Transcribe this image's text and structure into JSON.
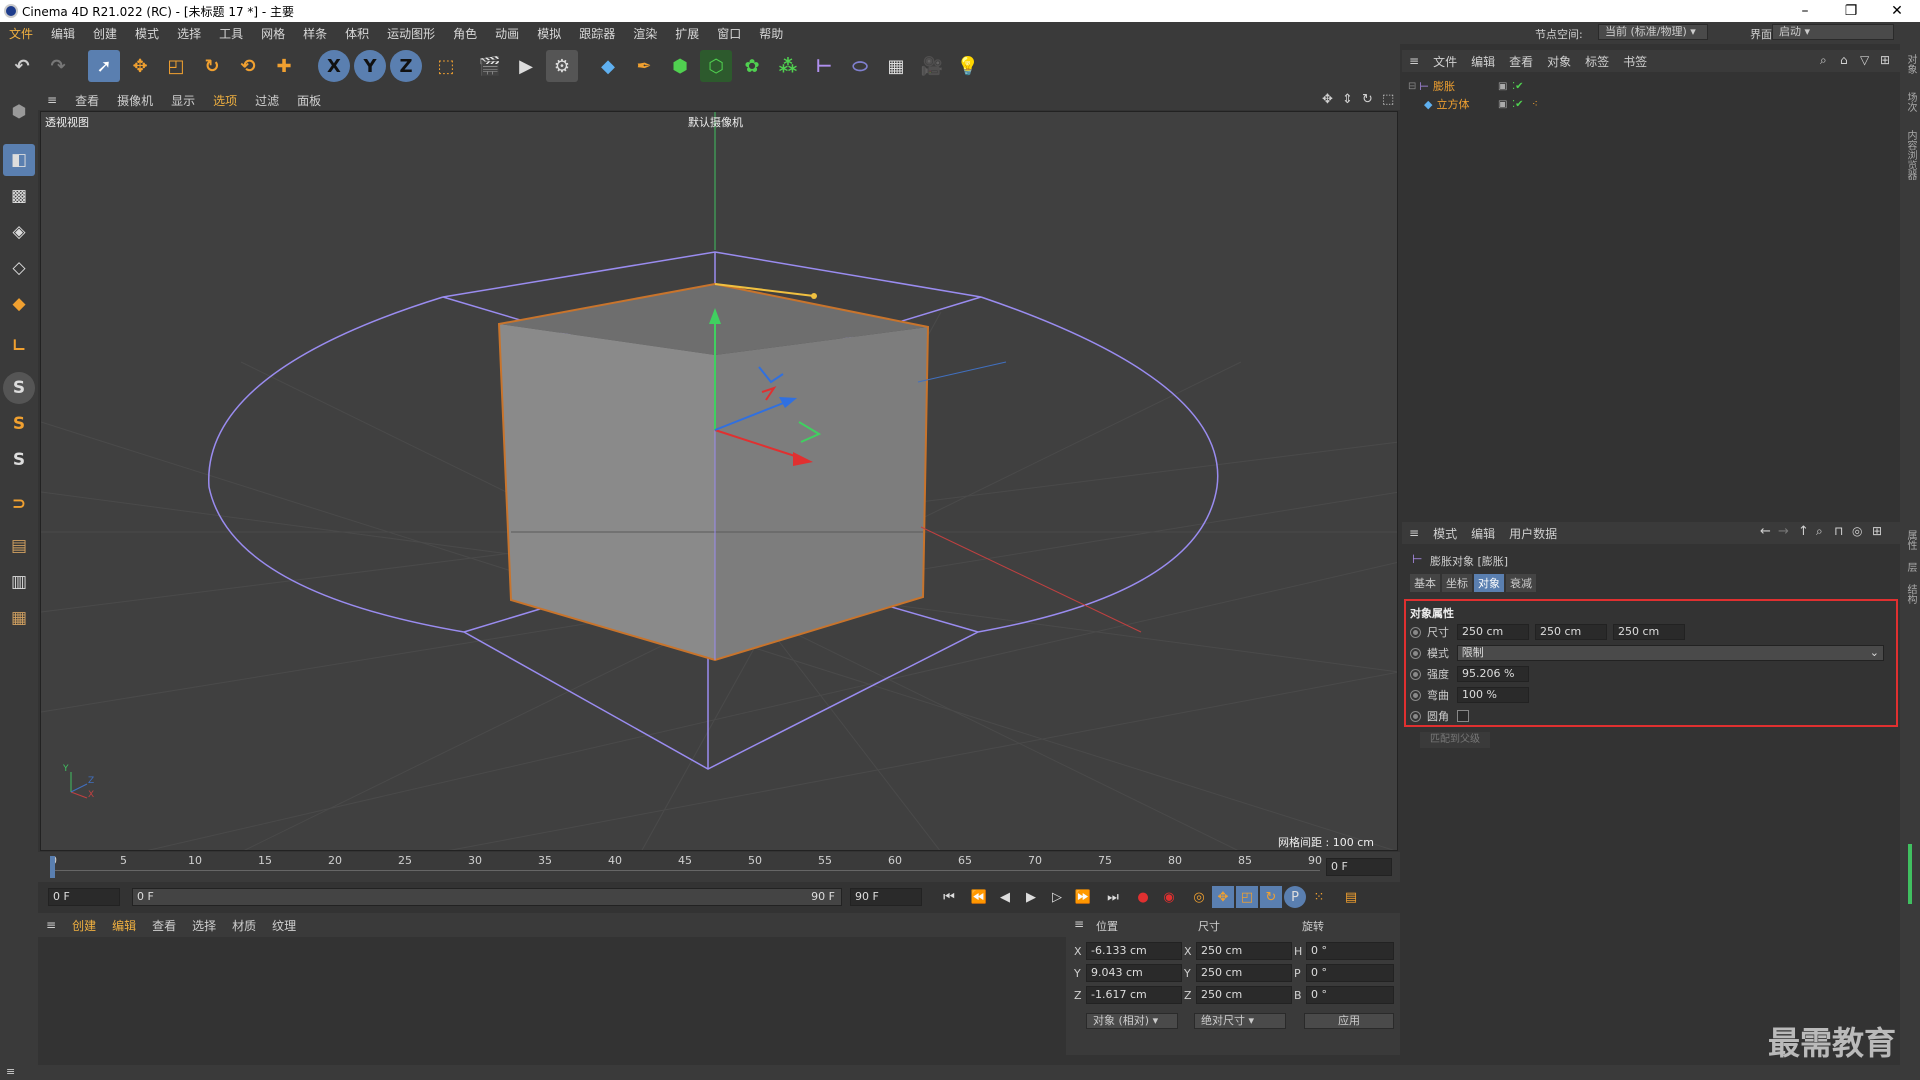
{
  "window": {
    "title": "Cinema 4D R21.022 (RC) - [未标题 17 *] - 主要",
    "min": "–",
    "max": "❐",
    "close": "✕"
  },
  "menubar": {
    "items": [
      "文件",
      "编辑",
      "创建",
      "模式",
      "选择",
      "工具",
      "网格",
      "样条",
      "体积",
      "运动图形",
      "角色",
      "动画",
      "模拟",
      "跟踪器",
      "渲染",
      "扩展",
      "窗口",
      "帮助"
    ],
    "node_space_label": "节点空间:",
    "node_space_value": "当前 (标准/物理)",
    "interface_label": "界面:",
    "interface_value": "启动"
  },
  "toolbar": {
    "axis_x": "X",
    "axis_y": "Y",
    "axis_z": "Z"
  },
  "viewport": {
    "menu": [
      "查看",
      "摄像机",
      "显示",
      "选项",
      "过滤",
      "面板"
    ],
    "view_name": "透视视图",
    "camera": "默认摄像机",
    "grid_spacing": "网格间距 : 100 cm",
    "axis_y": "Y",
    "axis_x": "X",
    "axis_z": "Z"
  },
  "timeline": {
    "ticks": [
      "0",
      "5",
      "10",
      "15",
      "20",
      "25",
      "30",
      "35",
      "40",
      "45",
      "50",
      "55",
      "60",
      "65",
      "70",
      "75",
      "80",
      "85",
      "90"
    ],
    "current_frame": "0 F",
    "start": "0 F",
    "range_start": "0 F",
    "range_end": "90 F",
    "end": "90 F"
  },
  "material_manager": {
    "menu": [
      "创建",
      "编辑",
      "查看",
      "选择",
      "材质",
      "纹理"
    ]
  },
  "coordinates": {
    "headers": [
      "位置",
      "尺寸",
      "旋转"
    ],
    "rows": [
      {
        "axis": "X",
        "pos": "-6.133 cm",
        "size_axis": "X",
        "size": "250 cm",
        "rot_axis": "H",
        "rot": "0 °"
      },
      {
        "axis": "Y",
        "pos": "9.043 cm",
        "size_axis": "Y",
        "size": "250 cm",
        "rot_axis": "P",
        "rot": "0 °"
      },
      {
        "axis": "Z",
        "pos": "-1.617 cm",
        "size_axis": "Z",
        "size": "250 cm",
        "rot_axis": "B",
        "rot": "0 °"
      }
    ],
    "mode": "对象 (相对)",
    "size_mode": "绝对尺寸",
    "apply": "应用"
  },
  "object_manager": {
    "menu": [
      "文件",
      "编辑",
      "查看",
      "对象",
      "标签",
      "书签"
    ],
    "objects": [
      {
        "name": "膨胀"
      },
      {
        "name": "立方体"
      }
    ]
  },
  "attribute_manager": {
    "menu": [
      "模式",
      "编辑",
      "用户数据"
    ],
    "title": "膨胀对象 [膨胀]",
    "tabs": [
      "基本",
      "坐标",
      "对象",
      "衰减"
    ],
    "active_tab": "对象",
    "section": "对象属性",
    "size_label": "尺寸",
    "size_values": [
      "250 cm",
      "250 cm",
      "250 cm"
    ],
    "mode_label": "模式",
    "mode_value": "限制",
    "strength_label": "强度",
    "strength_value": "95.206 %",
    "curvature_label": "弯曲",
    "curvature_value": "100 %",
    "fillet_label": "圆角",
    "fit_button": "匹配到父级",
    "highlight_color": "#e03030"
  },
  "right_strip_labels": [
    "对象",
    "场次",
    "内容浏览器",
    "属性",
    "层",
    "结构"
  ],
  "watermark": "最需教育"
}
